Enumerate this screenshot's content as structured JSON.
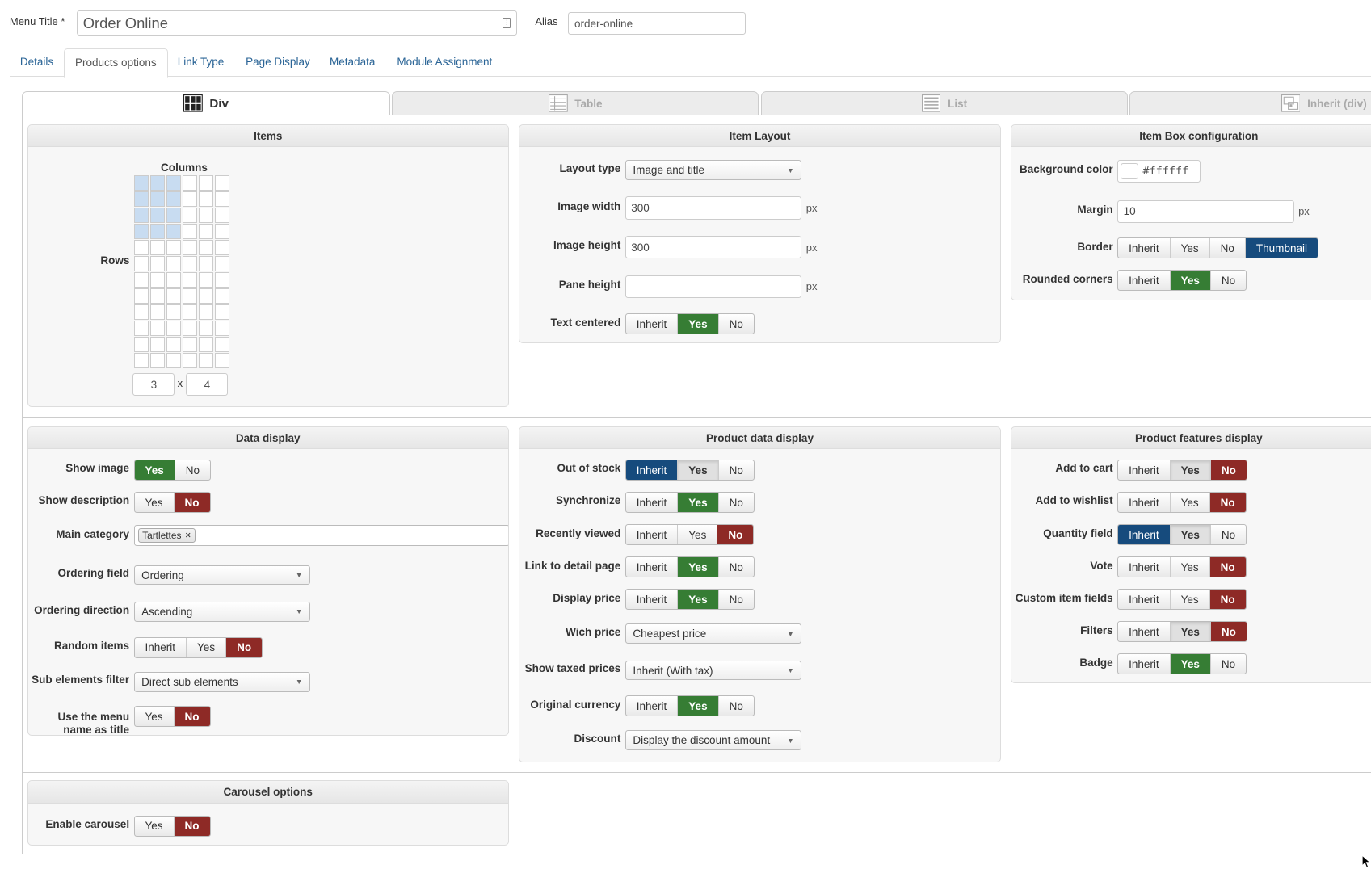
{
  "header": {
    "menu_title_label": "Menu Title *",
    "menu_title_value": "Order Online",
    "alias_label": "Alias",
    "alias_value": "order-online"
  },
  "tabs": [
    {
      "label": "Details",
      "active": false
    },
    {
      "label": "Products options",
      "active": true
    },
    {
      "label": "Link Type",
      "active": false
    },
    {
      "label": "Page Display",
      "active": false
    },
    {
      "label": "Metadata",
      "active": false
    },
    {
      "label": "Module Assignment",
      "active": false
    }
  ],
  "layout_tabs": [
    {
      "label": "Div",
      "icon": "div-grid-icon",
      "active": true
    },
    {
      "label": "Table",
      "icon": "table-icon",
      "active": false
    },
    {
      "label": "List",
      "icon": "list-icon",
      "active": false
    },
    {
      "label": "Inherit (div)",
      "icon": "inherit-icon",
      "active": false
    }
  ],
  "colors": {
    "green": "#367d34",
    "red": "#8e2a26",
    "blue": "#164b7d",
    "grid_selected": "#c8dcf1"
  },
  "items": {
    "title": "Items",
    "columns_label": "Columns",
    "rows_label": "Rows",
    "grid_columns": 6,
    "grid_rows": 12,
    "selected_columns": 3,
    "selected_rows": 4,
    "columns_value": "3",
    "times": "x",
    "rows_value": "4"
  },
  "panels": {
    "item_layout": {
      "title": "Item Layout",
      "fields": [
        {
          "label": "Layout type",
          "type": "select",
          "value": "Image and title"
        },
        {
          "label": "Image width",
          "type": "text",
          "value": "300",
          "unit": "px"
        },
        {
          "label": "Image height",
          "type": "text",
          "value": "300",
          "unit": "px"
        },
        {
          "label": "Pane height",
          "type": "text",
          "value": "",
          "unit": "px"
        },
        {
          "label": "Text centered",
          "type": "toggle",
          "options": [
            {
              "label": "Inherit",
              "state": ""
            },
            {
              "label": "Yes",
              "state": "green"
            },
            {
              "label": "No",
              "state": ""
            }
          ]
        }
      ]
    },
    "item_box": {
      "title": "Item Box configuration",
      "fields": [
        {
          "label": "Background color",
          "type": "color",
          "value": "#ffffff"
        },
        {
          "label": "Margin",
          "type": "text",
          "value": "10",
          "unit": "px"
        },
        {
          "label": "Border",
          "type": "toggle",
          "options": [
            {
              "label": "Inherit",
              "state": ""
            },
            {
              "label": "Yes",
              "state": ""
            },
            {
              "label": "No",
              "state": ""
            },
            {
              "label": "Thumbnail",
              "state": "blue"
            }
          ]
        },
        {
          "label": "Rounded corners",
          "type": "toggle",
          "options": [
            {
              "label": "Inherit",
              "state": ""
            },
            {
              "label": "Yes",
              "state": "green"
            },
            {
              "label": "No",
              "state": ""
            }
          ]
        }
      ]
    },
    "data_display": {
      "title": "Data display",
      "fields": [
        {
          "label": "Show image",
          "type": "toggle",
          "options": [
            {
              "label": "Yes",
              "state": "green"
            },
            {
              "label": "No",
              "state": ""
            }
          ]
        },
        {
          "label": "Show description",
          "type": "toggle",
          "options": [
            {
              "label": "Yes",
              "state": ""
            },
            {
              "label": "No",
              "state": "red"
            }
          ]
        },
        {
          "label": "Main category",
          "type": "tags",
          "tags": [
            "Tartlettes"
          ]
        },
        {
          "label": "Ordering field",
          "type": "select",
          "value": "Ordering"
        },
        {
          "label": "Ordering direction",
          "type": "select",
          "value": "Ascending"
        },
        {
          "label": "Random items",
          "type": "toggle",
          "options": [
            {
              "label": "Inherit",
              "state": ""
            },
            {
              "label": "Yes",
              "state": ""
            },
            {
              "label": "No",
              "state": "red"
            }
          ]
        },
        {
          "label": "Sub elements filter",
          "type": "select",
          "value": "Direct sub elements"
        },
        {
          "label": "Use the menu name as title",
          "type": "toggle",
          "options": [
            {
              "label": "Yes",
              "state": ""
            },
            {
              "label": "No",
              "state": "red"
            }
          ]
        }
      ]
    },
    "product_data": {
      "title": "Product data display",
      "fields": [
        {
          "label": "Out of stock",
          "type": "toggle",
          "options": [
            {
              "label": "Inherit",
              "state": "blue"
            },
            {
              "label": "Yes",
              "state": "pressed"
            },
            {
              "label": "No",
              "state": ""
            }
          ]
        },
        {
          "label": "Synchronize",
          "type": "toggle",
          "options": [
            {
              "label": "Inherit",
              "state": ""
            },
            {
              "label": "Yes",
              "state": "green"
            },
            {
              "label": "No",
              "state": ""
            }
          ]
        },
        {
          "label": "Recently viewed",
          "type": "toggle",
          "options": [
            {
              "label": "Inherit",
              "state": ""
            },
            {
              "label": "Yes",
              "state": ""
            },
            {
              "label": "No",
              "state": "red"
            }
          ]
        },
        {
          "label": "Link to detail page",
          "type": "toggle",
          "options": [
            {
              "label": "Inherit",
              "state": ""
            },
            {
              "label": "Yes",
              "state": "green"
            },
            {
              "label": "No",
              "state": ""
            }
          ]
        },
        {
          "label": "Display price",
          "type": "toggle",
          "options": [
            {
              "label": "Inherit",
              "state": ""
            },
            {
              "label": "Yes",
              "state": "green"
            },
            {
              "label": "No",
              "state": ""
            }
          ]
        },
        {
          "label": "Wich price",
          "type": "select",
          "value": "Cheapest price"
        },
        {
          "label": "Show taxed prices",
          "type": "select",
          "value": "Inherit (With tax)"
        },
        {
          "label": "Original currency",
          "type": "toggle",
          "options": [
            {
              "label": "Inherit",
              "state": ""
            },
            {
              "label": "Yes",
              "state": "green"
            },
            {
              "label": "No",
              "state": ""
            }
          ]
        },
        {
          "label": "Discount",
          "type": "select",
          "value": "Display the discount amount"
        }
      ]
    },
    "features": {
      "title": "Product features display",
      "fields": [
        {
          "label": "Add to cart",
          "type": "toggle",
          "options": [
            {
              "label": "Inherit",
              "state": ""
            },
            {
              "label": "Yes",
              "state": "pressed"
            },
            {
              "label": "No",
              "state": "red"
            }
          ]
        },
        {
          "label": "Add to wishlist",
          "type": "toggle",
          "options": [
            {
              "label": "Inherit",
              "state": ""
            },
            {
              "label": "Yes",
              "state": ""
            },
            {
              "label": "No",
              "state": "red"
            }
          ]
        },
        {
          "label": "Quantity field",
          "type": "toggle",
          "options": [
            {
              "label": "Inherit",
              "state": "blue"
            },
            {
              "label": "Yes",
              "state": "pressed"
            },
            {
              "label": "No",
              "state": ""
            }
          ]
        },
        {
          "label": "Vote",
          "type": "toggle",
          "options": [
            {
              "label": "Inherit",
              "state": ""
            },
            {
              "label": "Yes",
              "state": ""
            },
            {
              "label": "No",
              "state": "red"
            }
          ]
        },
        {
          "label": "Custom item fields",
          "type": "toggle",
          "options": [
            {
              "label": "Inherit",
              "state": ""
            },
            {
              "label": "Yes",
              "state": ""
            },
            {
              "label": "No",
              "state": "red"
            }
          ]
        },
        {
          "label": "Filters",
          "type": "toggle",
          "options": [
            {
              "label": "Inherit",
              "state": ""
            },
            {
              "label": "Yes",
              "state": "pressed"
            },
            {
              "label": "No",
              "state": "red"
            }
          ]
        },
        {
          "label": "Badge",
          "type": "toggle",
          "options": [
            {
              "label": "Inherit",
              "state": ""
            },
            {
              "label": "Yes",
              "state": "green"
            },
            {
              "label": "No",
              "state": ""
            }
          ]
        }
      ]
    },
    "carousel": {
      "title": "Carousel options",
      "fields": [
        {
          "label": "Enable carousel",
          "type": "toggle",
          "options": [
            {
              "label": "Yes",
              "state": ""
            },
            {
              "label": "No",
              "state": "red"
            }
          ]
        }
      ]
    }
  }
}
